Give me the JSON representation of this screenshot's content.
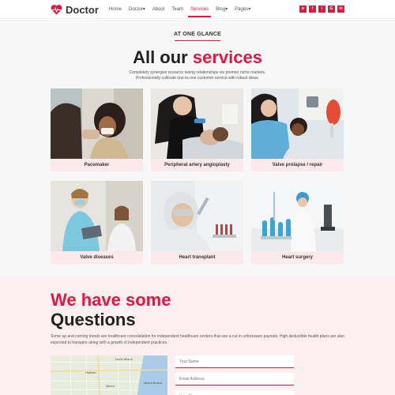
{
  "header": {
    "logo_text": "Doctor",
    "nav": [
      {
        "label": "Home"
      },
      {
        "label": "Doctor▾"
      },
      {
        "label": "About"
      },
      {
        "label": "Team"
      },
      {
        "label": "Services",
        "active": true
      },
      {
        "label": "Blog▾"
      },
      {
        "label": "Pages▾"
      }
    ],
    "socials": [
      {
        "icon": "rss-icon",
        "glyph": "ʀ"
      },
      {
        "icon": "facebook-icon",
        "glyph": "f"
      },
      {
        "icon": "twitter-icon",
        "glyph": "t"
      },
      {
        "icon": "google-plus-icon",
        "glyph": "G"
      },
      {
        "icon": "linkedin-icon",
        "glyph": "in"
      }
    ]
  },
  "services": {
    "eyebrow": "AT ONE GLANCE",
    "title_plain": "All our ",
    "title_accent": "services",
    "intro_line1": "Completely synergize resource taxing relationships via premier niche markets.",
    "intro_line2": "Professionally cultivate one-to-one customer service with robust ideas.",
    "cards": [
      {
        "label": "Pacemaker"
      },
      {
        "label": "Peripheral artery angioplasty"
      },
      {
        "label": "Valve prolapse / repair"
      },
      {
        "label": "Valve diseases"
      },
      {
        "label": "Heart transplant"
      },
      {
        "label": "Heart surgery"
      }
    ]
  },
  "questions": {
    "title_line1": "We have some",
    "title_line2": "Questions",
    "description": "Some up and coming trends are healthcare consolidation for independent healthcare centers that see a cut in unforeseen payouts. High deductible health plans are also expected to transpire along with a growth of independent practices.",
    "map_labels": [
      "North Miami",
      "Hialeah",
      "Miami",
      "Miami Beach"
    ],
    "form": {
      "name_placeholder": "Your Name",
      "email_placeholder": "Email Address",
      "third_placeholder": "Your Phone"
    }
  },
  "colors": {
    "accent": "#e3173e",
    "card_label_bg": "#fbe9ec",
    "questions_bg": "#fdeef0"
  }
}
